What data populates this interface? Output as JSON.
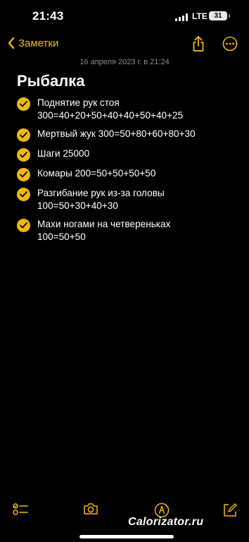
{
  "status": {
    "time": "21:43",
    "network": "LTE",
    "battery": "31"
  },
  "nav": {
    "back_label": "Заметки"
  },
  "note": {
    "date": "16 апреля 2023 г. в 21:24",
    "title": "Рыбалка",
    "items": [
      {
        "text": "Поднятие рук стоя\n300=40+20+50+40+40+50+40+25",
        "checked": true
      },
      {
        "text": "Мертвый жук 300=50+80+60+80+30",
        "checked": true
      },
      {
        "text": "Шаги 25000",
        "checked": true
      },
      {
        "text": "Комары 200=50+50+50+50",
        "checked": true
      },
      {
        "text": "Разгибание рук из-за головы\n100=50+30+40+30",
        "checked": true
      },
      {
        "text": "Махи ногами на четвереньках\n100=50+50",
        "checked": true
      }
    ]
  },
  "toolbar": {
    "icons": [
      "checklist-icon",
      "camera-icon",
      "markup-icon",
      "compose-icon"
    ]
  },
  "watermark": "Calorizator.ru",
  "colors": {
    "accent": "#f2b90c",
    "background": "#000000",
    "secondary_text": "#8d8d92"
  }
}
